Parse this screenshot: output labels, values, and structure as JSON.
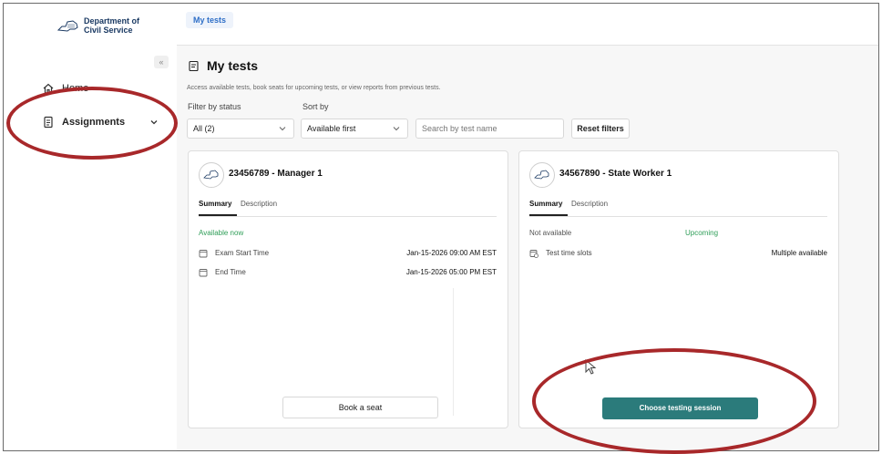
{
  "sidebar": {
    "logo_line1": "Department of",
    "logo_line2": "Civil Service",
    "collapse_icon": "«",
    "items": [
      {
        "label": "Home",
        "icon": "home-icon"
      },
      {
        "label": "Assignments",
        "icon": "document-icon"
      }
    ]
  },
  "topbar": {
    "tab_label": "My tests"
  },
  "main": {
    "title": "My tests",
    "subtitle": "Access available tests, book seats for upcoming tests, or view reports from previous tests.",
    "filter_label": "Filter by status",
    "filter_value": "All (2)",
    "sort_label": "Sort by",
    "sort_value": "Available first",
    "search_placeholder": "Search by test name",
    "reset_label": "Reset filters"
  },
  "cards": [
    {
      "title": "23456789 - Manager 1",
      "tab_summary": "Summary",
      "tab_description": "Description",
      "status": "Available now",
      "rows": [
        {
          "key": "Exam Start Time",
          "value": "Jan-15-2026 09:00 AM EST"
        },
        {
          "key": "End Time",
          "value": "Jan-15-2026 05:00 PM EST"
        }
      ],
      "action_label": "Book a seat"
    },
    {
      "title": "34567890 - State Worker 1",
      "tab_summary": "Summary",
      "tab_description": "Description",
      "status": "Not available",
      "status_secondary": "Upcoming",
      "rows": [
        {
          "key": "Test time slots",
          "value": "Multiple available"
        }
      ],
      "action_label": "Choose testing session"
    }
  ],
  "colors": {
    "accent_teal": "#2b7b7b",
    "status_green": "#2f9e58",
    "annotation_red": "#a8282a",
    "link_blue": "#2f6fc7"
  }
}
